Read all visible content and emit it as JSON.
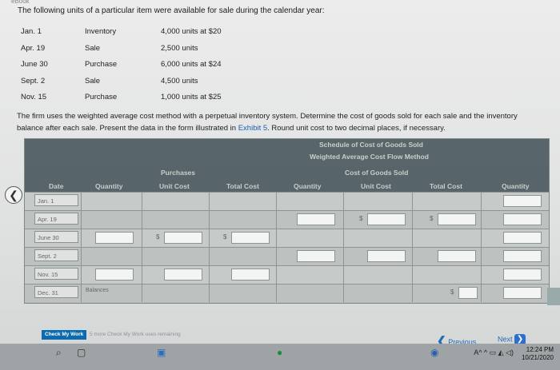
{
  "header": {
    "crumb": "eBook",
    "intro": "The following units of a particular item were available for sale during the calendar year:"
  },
  "inventory": [
    {
      "date": "Jan. 1",
      "type": "Inventory",
      "detail": "4,000 units at $20"
    },
    {
      "date": "Apr. 19",
      "type": "Sale",
      "detail": "2,500 units"
    },
    {
      "date": "June 30",
      "type": "Purchase",
      "detail": "6,000 units at $24"
    },
    {
      "date": "Sept. 2",
      "type": "Sale",
      "detail": "4,500 units"
    },
    {
      "date": "Nov. 15",
      "type": "Purchase",
      "detail": "1,000 units at $25"
    }
  ],
  "instructions": {
    "text1": "The firm uses the weighted average cost method with a perpetual inventory system. Determine the cost of goods sold for each sale and the inventory balance after each sale. Present the data in the form illustrated in ",
    "link": "Exhibit 5",
    "text2": ". Round unit cost to two decimal places, if necessary."
  },
  "schedule": {
    "title1": "Schedule of Cost of Goods Sold",
    "title2": "Weighted Average Cost Flow Method",
    "group_purchases": "Purchases",
    "group_cogs": "Cost of Goods Sold",
    "columns": {
      "date": "Date",
      "p_qty": "Quantity",
      "p_unit": "Unit Cost",
      "p_total": "Total Cost",
      "c_qty": "Quantity",
      "c_unit": "Unit Cost",
      "c_total": "Total Cost",
      "i_qty": "Quantity"
    },
    "rows": [
      {
        "date": "Jan. 1"
      },
      {
        "date": "Apr. 19"
      },
      {
        "date": "June 30"
      },
      {
        "date": "Sept. 2"
      },
      {
        "date": "Nov. 15"
      },
      {
        "date": "Dec. 31",
        "note": "Balances"
      }
    ],
    "dollar_sign": "$"
  },
  "footer": {
    "check_label": "Check My Work",
    "remaining": "5 more Check My Work uses remaining",
    "previous": "Previous",
    "next": "Next",
    "prev_glyph": "❮",
    "next_glyph": "❯",
    "back_glyph": "❮"
  },
  "taskbar": {
    "time": "12:24 PM",
    "date": "10/21/2020",
    "tray": "A^ ^ ▭ ◭ ◁)"
  }
}
